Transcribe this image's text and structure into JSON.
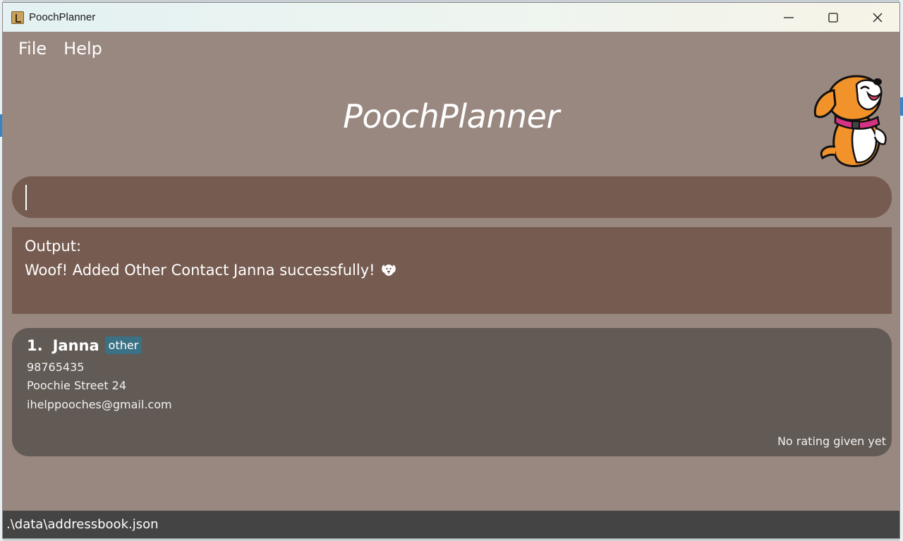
{
  "window": {
    "title": "PoochPlanner",
    "controls": {
      "minimize": "minimize-icon",
      "maximize": "maximize-icon",
      "close": "close-icon"
    }
  },
  "menu": {
    "file": "File",
    "help": "Help"
  },
  "header": {
    "title": "PoochPlanner",
    "mascot": "dog-mascot-icon"
  },
  "command": {
    "value": "",
    "placeholder": ""
  },
  "result": {
    "label": "Output:",
    "message": "Woof! Added Other Contact Janna successfully!",
    "icon": "dog-face-icon"
  },
  "contacts": [
    {
      "index": "1.",
      "name": "Janna",
      "tag": "other",
      "phone": "98765435",
      "address": "Poochie Street 24",
      "email": "ihelppooches@gmail.com",
      "rating": "No rating given yet"
    }
  ],
  "status": {
    "file_path": ".\\data\\addressbook.json"
  },
  "colors": {
    "window_bg": "#998880",
    "box_bg": "#765b50",
    "card_bg": "#625a55",
    "tag_bg": "#3a7185",
    "status_bg": "#444444"
  }
}
